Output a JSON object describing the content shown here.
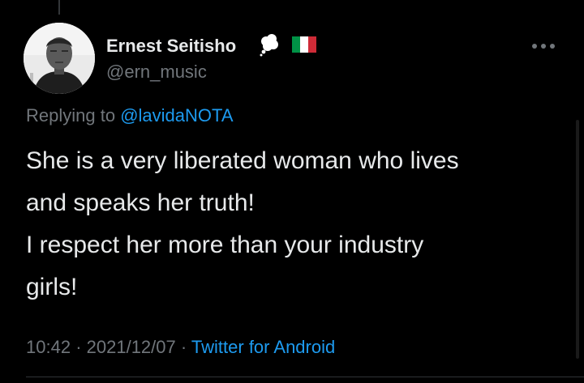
{
  "author": {
    "name": "Ernest Seitisho",
    "handle": "@ern_music"
  },
  "reply": {
    "prefix": "Replying to",
    "mention": "@lavidaNOTA"
  },
  "tweet": {
    "lines": [
      "She is a very liberated woman who lives",
      "and speaks her truth!",
      "I respect her more than your industry",
      "girls!"
    ]
  },
  "meta": {
    "time": "10:42",
    "separator": "·",
    "date": "2021/12/07",
    "source": "Twitter for Android"
  },
  "icons": {
    "name_emoji": "thought-balloon-icon",
    "flag": "italy-flag-icon",
    "more": "more-options-icon"
  },
  "colors": {
    "background": "#000000",
    "primary_text": "#e7e9ea",
    "secondary_text": "#71767b",
    "link": "#1d9bf0"
  }
}
